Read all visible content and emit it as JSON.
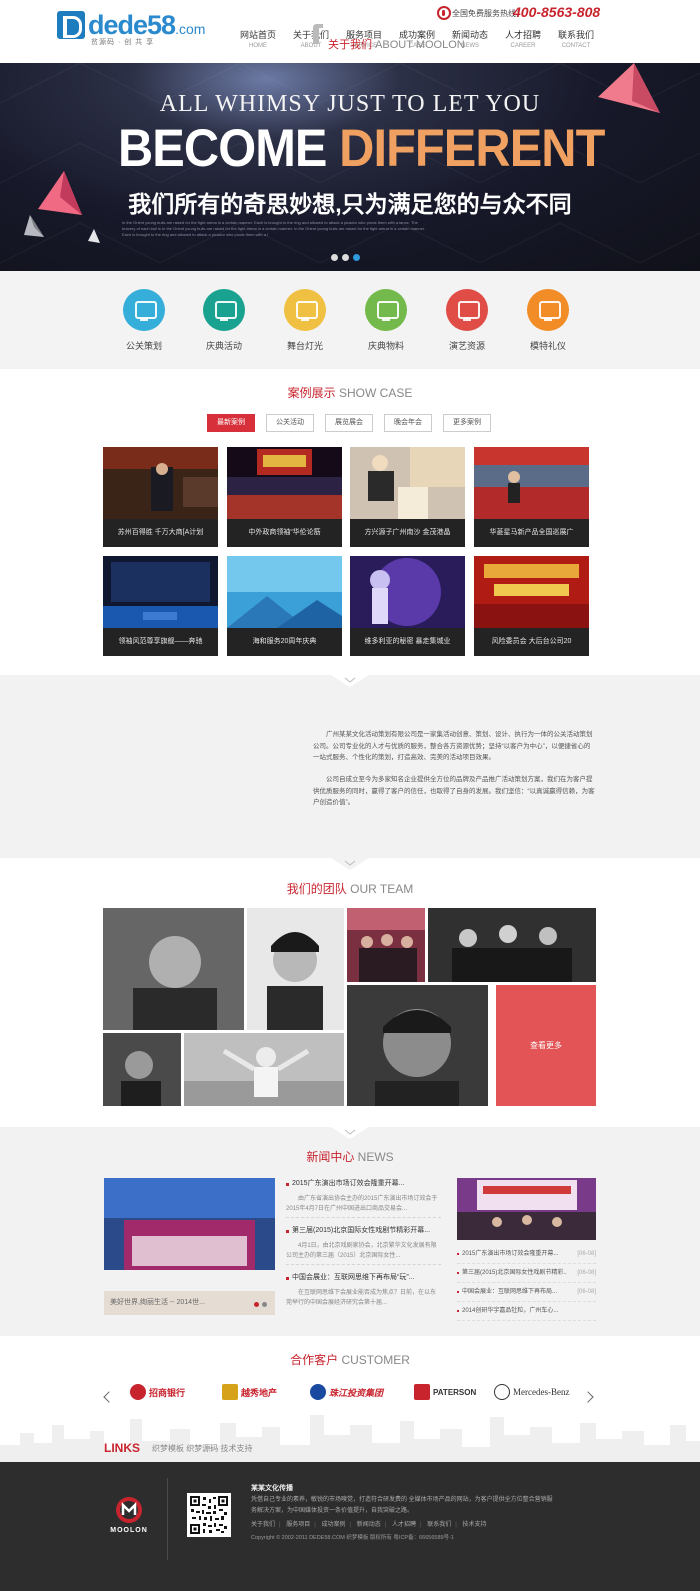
{
  "header": {
    "logo_text": "dede58",
    "logo_suffix": ".com",
    "logo_slogan": "贫源码 · 创 共 享",
    "hotline_label": "全国免费服务热线：",
    "hotline_number": "400-8563-808"
  },
  "nav": [
    {
      "cn": "网站首页",
      "en": "HOME"
    },
    {
      "cn": "关于我们",
      "en": "ABOUT"
    },
    {
      "cn": "服务项目",
      "en": "SERVICE"
    },
    {
      "cn": "成功案例",
      "en": "CASE"
    },
    {
      "cn": "新闻动态",
      "en": "NEWS"
    },
    {
      "cn": "人才招聘",
      "en": "CAREER"
    },
    {
      "cn": "联系我们",
      "en": "CONTACT"
    }
  ],
  "banner": {
    "line1": "ALL WHIMSY JUST TO LET YOU",
    "word1": "BECOME",
    "word2": "DIFFERENT",
    "cn": "我们所有的奇思妙想,只为满足您的与众不同",
    "fine": "In the Orient young bulls are raised for the fight arena in a certain manner. Each is brought to the ring and allowed to attack a picador who prods them with a lance. The bravery of each bull is In the Orient young bulls are raised for the fight arena in a certain manner. In the Orient young bulls are raised for the fight arena in a certain manner. Each is brought to the ring and allowed to attack a picador who prods them with a l",
    "slides": 3,
    "active_slide": 3
  },
  "services": [
    {
      "label": "公关策划",
      "color": "#35aed9"
    },
    {
      "label": "庆典活动",
      "color": "#19a290"
    },
    {
      "label": "舞台灯光",
      "color": "#f0c043"
    },
    {
      "label": "庆典物料",
      "color": "#73b94b"
    },
    {
      "label": "演艺资源",
      "color": "#e04d47"
    },
    {
      "label": "模特礼仪",
      "color": "#f28c27"
    }
  ],
  "cases": {
    "title_cn": "案例展示",
    "title_en": "SHOW CASE",
    "tabs": [
      "最新案例",
      "公关活动",
      "展览展会",
      "晚会年会",
      "更多案例"
    ],
    "active_tab": 0,
    "items": [
      {
        "caption": "苏州百得胜 千万大商[A计划"
      },
      {
        "caption": "中外政商领袖“华伦论筋"
      },
      {
        "caption": "方兴源子广州南沙 金茂港晶"
      },
      {
        "caption": "华菱星马新产品全国巡展广"
      },
      {
        "caption": "领袖风范尊享旗舰——奔驰"
      },
      {
        "caption": "海和服务20周年庆典"
      },
      {
        "caption": "维多利亚的秘密 暴走集城业"
      },
      {
        "caption": "风险委员会 大后台公司20"
      }
    ]
  },
  "about": {
    "title_cn": "关于我们",
    "title_en": "ABOUT MOOLON",
    "p1": "广州某某文化活动策划有限公司是一家集活动创意、策划、设计、执行为一体的公关活动策划公司。公司专业化的人才与优质的服务，整合各方资源优势；坚持“以客户为中心”，以便捷省心的一站式服务、个性化的策划，打造高效、完美的活动项目效果。",
    "p2": "公司自成立至今为多家知名企业提供全方位的品牌及产品推广活动策划方案，我们在为客户提供优质服务的同时，赢得了客户的信任，也取得了自身的发展。我们坚信：“以真诚赢得信赖，为客户创造价值”。"
  },
  "team": {
    "title_cn": "我们的团队",
    "title_en": "OUR TEAM",
    "more_label": "查看更多"
  },
  "news": {
    "title_cn": "新闻中心",
    "title_en": "NEWS",
    "featured_caption": "美好世界,绚丽生活 -- 2014世...",
    "items": [
      {
        "title": "2015广东演出市场订效会隆重开幕...",
        "desc": "由广东省演出协会主办的2015广东演出市场订效会于2015年4月7日在广州中国进出口商品交易会..."
      },
      {
        "title": "第三届(2015)北京国际女性戏剧节精彩开幕...",
        "desc": "4月1日，由北京戏剧家协会，北京繁华文化发展有限公司主办的第三届（2015）北京国际女性..."
      },
      {
        "title": "中国会展业：互联网思维下再布局“玩”...",
        "desc": "在互联网思维下会展业能否成为焦点？日前，在以东莞举行的中国会展经济研究会第十届..."
      }
    ],
    "list": [
      {
        "title": "2015广东演出市场订效会隆重开幕...",
        "date": "[06-08]"
      },
      {
        "title": "第三届(2015)北京国际女性戏剧节精彩...",
        "date": "[06-08]"
      },
      {
        "title": "中国会展业：互联网思维下再布局...",
        "date": "[06-08]"
      },
      {
        "title": "2014创研华宇嘉品牡粒，广州车心...",
        "date": "[06-08]"
      }
    ]
  },
  "customers": {
    "title_cn": "合作客户",
    "title_en": "CUSTOMER",
    "logos": [
      {
        "name": "招商银行",
        "color": "#c8242e"
      },
      {
        "name": "越秀地产",
        "color": "#d6a21a"
      },
      {
        "name": "珠江投资集团",
        "color": "#c8242e"
      },
      {
        "name": "PATERSON",
        "color": "#c8242e"
      },
      {
        "name": "Mercedes-Benz",
        "color": "#333333"
      }
    ]
  },
  "links": {
    "label": "LINKS",
    "items": [
      "织梦模板",
      "织梦源码",
      "技术支持"
    ]
  },
  "footer": {
    "logo_text": "MOOLON",
    "company": "某某文化传播",
    "desc": "凭借自己专业的素养，敏锐的市场嗅觉，打造符合研发费的 全媒体市场产品的网站，为客户提供全方位整合营销服务解决方案，为中国媒体投资一条价值提升，自我突破之路。",
    "nav": [
      "关于我们",
      "服务项目",
      "成功案例",
      "新闻动态",
      "人才招聘",
      "联系我们",
      "技术支持"
    ],
    "copyright": "Copyright © 2002-2011 DEDE58.COM 织梦模板 版权所有",
    "icp": "粤ICP备：66656589号-1"
  }
}
